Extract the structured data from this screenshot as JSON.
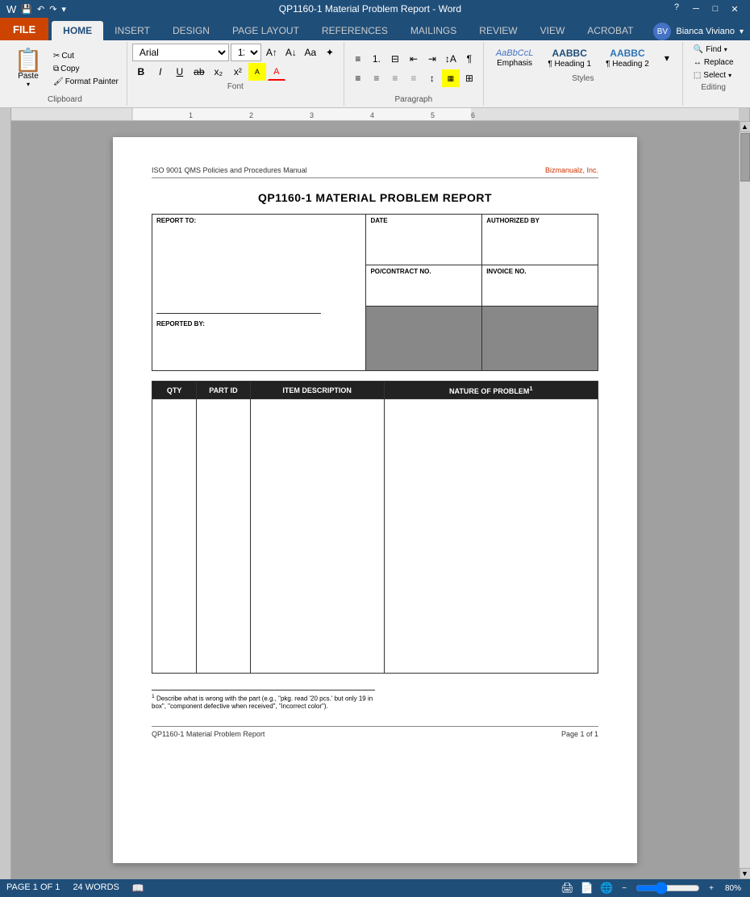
{
  "titleBar": {
    "title": "QP1160-1 Material Problem Report - Word",
    "appName": "Word",
    "controls": [
      "─",
      "□",
      "✕"
    ]
  },
  "ribbon": {
    "tabs": [
      "FILE",
      "HOME",
      "INSERT",
      "DESIGN",
      "PAGE LAYOUT",
      "REFERENCES",
      "MAILINGS",
      "REVIEW",
      "VIEW",
      "ACROBAT"
    ],
    "activeTab": "HOME",
    "clipboard": {
      "paste": "Paste",
      "cut": "Cut",
      "copy": "Copy",
      "formatPainter": "Format Painter",
      "groupLabel": "Clipboard"
    },
    "font": {
      "fontName": "Arial",
      "fontSize": "12",
      "groupLabel": "Font"
    },
    "paragraph": {
      "groupLabel": "Paragraph"
    },
    "styles": {
      "items": [
        "Emphasis",
        "¶ Heading 1",
        "¶ Heading 2"
      ],
      "groupLabel": "Styles"
    },
    "editing": {
      "find": "Find",
      "replace": "Replace",
      "select": "Select",
      "groupLabel": "Editing"
    },
    "user": "Bianca Viviano"
  },
  "document": {
    "pageHeader": {
      "left": "ISO 9001 QMS Policies and Procedures Manual",
      "right": "Bizmanualz, Inc."
    },
    "title": "QP1160-1 MATERIAL PROBLEM REPORT",
    "formFields": {
      "reportTo": "REPORT TO:",
      "date": "DATE",
      "authorizedBy": "AUTHORIZED BY",
      "poContractNo": "PO/CONTRACT NO.",
      "invoiceNo": "INVOICE NO.",
      "reportedBy": "REPORTED BY:"
    },
    "itemsTable": {
      "headers": [
        "QTY",
        "PART ID",
        "ITEM DESCRIPTION",
        "NATURE OF PROBLEM¹"
      ],
      "colWidths": [
        "10%",
        "12%",
        "30%",
        "48%"
      ]
    },
    "footnote": {
      "superscript": "1",
      "text": " Describe what is wrong with the part (e.g., \"pkg. read '20 pcs.' but only 19 in box\", \"component defective when received\", \"incorrect color\")."
    },
    "pageFooter": {
      "left": "QP1160-1 Material Problem Report",
      "right": "Page 1 of 1"
    }
  },
  "statusBar": {
    "page": "PAGE 1 OF 1",
    "words": "24 WORDS",
    "zoom": "80%",
    "zoomSlider": 80
  }
}
